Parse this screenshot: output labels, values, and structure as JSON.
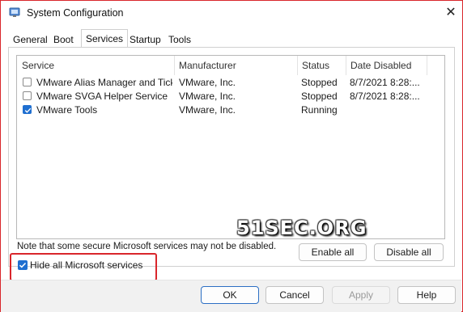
{
  "window": {
    "title": "System Configuration"
  },
  "tabs": [
    {
      "label": "General",
      "active": false
    },
    {
      "label": "Boot",
      "active": false
    },
    {
      "label": "Services",
      "active": true
    },
    {
      "label": "Startup",
      "active": false
    },
    {
      "label": "Tools",
      "active": false
    }
  ],
  "services_table": {
    "columns": [
      "Service",
      "Manufacturer",
      "Status",
      "Date Disabled"
    ],
    "rows": [
      {
        "checked": false,
        "service": "VMware Alias Manager and Ticke...",
        "manufacturer": "VMware, Inc.",
        "status": "Stopped",
        "date_disabled": "8/7/2021 8:28:..."
      },
      {
        "checked": false,
        "service": "VMware SVGA Helper Service",
        "manufacturer": "VMware, Inc.",
        "status": "Stopped",
        "date_disabled": "8/7/2021 8:28:..."
      },
      {
        "checked": true,
        "service": "VMware Tools",
        "manufacturer": "VMware, Inc.",
        "status": "Running",
        "date_disabled": ""
      }
    ]
  },
  "note": "Note that some secure Microsoft services may not be disabled.",
  "buttons": {
    "enable_all": "Enable all",
    "disable_all": "Disable all",
    "ok": "OK",
    "cancel": "Cancel",
    "apply": "Apply",
    "help": "Help"
  },
  "hide_ms": {
    "label": "Hide all Microsoft services",
    "checked": true
  },
  "watermark": "51SEC.ORG",
  "colors": {
    "accent": "#1f6fd0",
    "highlight": "#d9262b"
  }
}
